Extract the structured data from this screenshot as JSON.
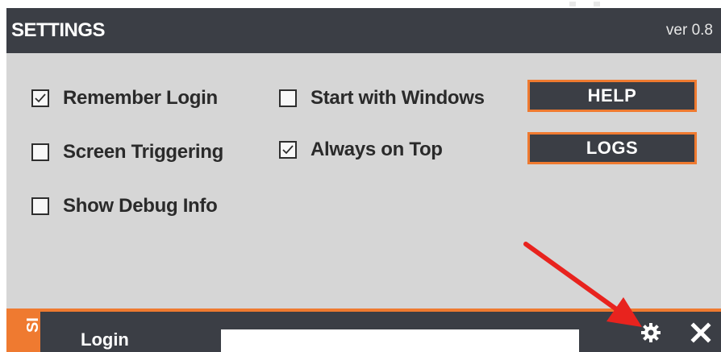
{
  "window": {
    "title": "SETTINGS",
    "version": "ver 0.8"
  },
  "settings": {
    "checkboxes": [
      {
        "label": "Remember Login",
        "checked": true
      },
      {
        "label": "Screen Triggering",
        "checked": false
      },
      {
        "label": "Show Debug Info",
        "checked": false
      },
      {
        "label": "Start with Windows",
        "checked": false
      },
      {
        "label": "Always on Top",
        "checked": true
      }
    ],
    "buttons": {
      "help": "HELP",
      "logs": "LOGS"
    }
  },
  "bottom_bar": {
    "side_tab": "SI",
    "login_label": "Login",
    "login_value": "",
    "icons": [
      "gear-icon",
      "close-icon"
    ]
  },
  "annotation": {
    "arrow_color": "#e8231e"
  },
  "colors": {
    "accent": "#ef7a30",
    "dark": "#3b3e45",
    "panel": "#d6d6d6"
  }
}
